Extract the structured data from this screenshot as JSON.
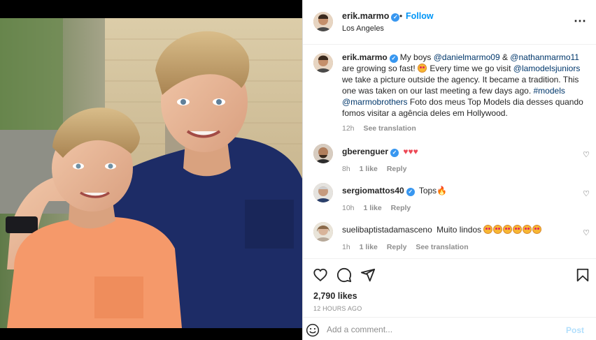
{
  "post": {
    "username": "erik.marmo",
    "separator": "•",
    "follow_label": "Follow",
    "location": "Los Angeles",
    "more_icon": "more-options-icon"
  },
  "caption": {
    "username": "erik.marmo",
    "text_1": "My boys ",
    "mention_1": "@danielmarmo09",
    "text_2": " & ",
    "mention_2": "@nathanmarmo11",
    "text_3": " are growing so fast! ",
    "text_4": " Every time we go visit ",
    "mention_3": "@lamodelsjuniors",
    "text_5": " we take a picture outside the agency. It became a tradition. This one was taken on our last meeting a few days ago. ",
    "hashtag": "#models",
    "mention_4": "@marmobrothers",
    "text_6": " Foto dos meus Top Models dia desses quando fomos visitar a agência deles em Hollywood.",
    "time": "12h",
    "see_translation": "See translation"
  },
  "comments": [
    {
      "username": "gberenguer",
      "text": "♥♥♥",
      "time": "8h",
      "likes": "1 like",
      "reply": "Reply"
    },
    {
      "username": "sergiomattos40",
      "text": "Tops",
      "time": "10h",
      "likes": "1 like",
      "reply": "Reply"
    },
    {
      "username": "suelibaptistadamasceno",
      "text": "Muito lindos ",
      "time": "1h",
      "likes": "1 like",
      "reply": "Reply",
      "see_translation": "See translation"
    }
  ],
  "actions": {
    "icons": [
      "heart-icon",
      "comment-icon",
      "share-icon",
      "bookmark-icon"
    ],
    "likes": "2,790 likes",
    "time_ago": "12 HOURS AGO"
  },
  "add_comment": {
    "placeholder": "Add a comment...",
    "post_label": "Post"
  },
  "colors": {
    "link_blue": "#0095f6",
    "verified_blue": "#3897f0",
    "mention": "#00376b",
    "muted": "#8e8e8e"
  }
}
